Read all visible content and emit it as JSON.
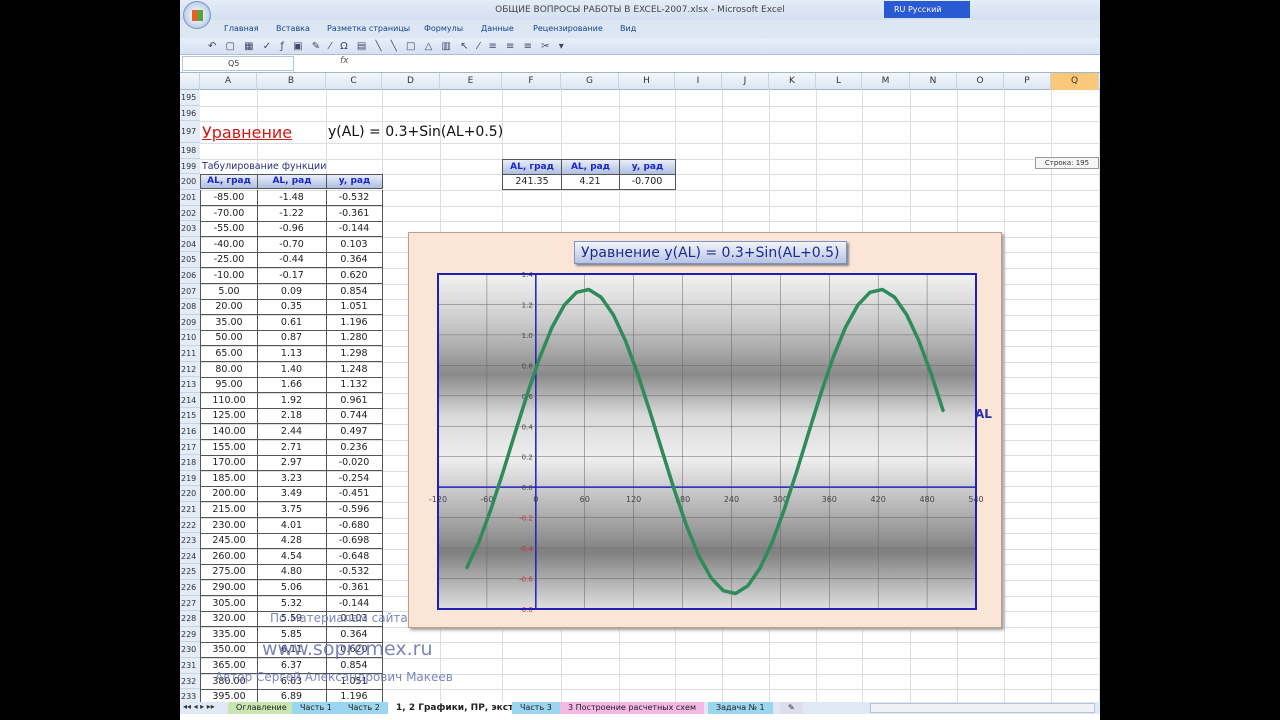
{
  "window": {
    "title": "ОБЩИЕ ВОПРОСЫ РАБОТЫ В EXCEL-2007.xlsx - Microsoft Excel",
    "language": "RU Русский"
  },
  "ribbon_tabs": [
    "Главная",
    "Вставка",
    "Разметка страницы",
    "Формулы",
    "Данные",
    "Рецензирование",
    "Вид"
  ],
  "name_box": "Q5",
  "formula_icon": "fx",
  "columns": [
    "A",
    "B",
    "C",
    "D",
    "E",
    "F",
    "G",
    "H",
    "I",
    "J",
    "K",
    "L",
    "M",
    "N",
    "O",
    "P",
    "Q"
  ],
  "selected_column": "Q",
  "sheet": {
    "equation_label": "Уравнение",
    "equation": "y(AL) = 0.3+Sin(AL+0.5)",
    "tab_title": "Табулирование функции",
    "headers": [
      "AL, град",
      "AL, рад",
      "y, рад"
    ],
    "rows": [
      [
        "-85.00",
        "-1.48",
        "-0.532"
      ],
      [
        "-70.00",
        "-1.22",
        "-0.361"
      ],
      [
        "-55.00",
        "-0.96",
        "-0.144"
      ],
      [
        "-40.00",
        "-0.70",
        "0.103"
      ],
      [
        "-25.00",
        "-0.44",
        "0.364"
      ],
      [
        "-10.00",
        "-0.17",
        "0.620"
      ],
      [
        "5.00",
        "0.09",
        "0.854"
      ],
      [
        "20.00",
        "0.35",
        "1.051"
      ],
      [
        "35.00",
        "0.61",
        "1.196"
      ],
      [
        "50.00",
        "0.87",
        "1.280"
      ],
      [
        "65.00",
        "1.13",
        "1.298"
      ],
      [
        "80.00",
        "1.40",
        "1.248"
      ],
      [
        "95.00",
        "1.66",
        "1.132"
      ],
      [
        "110.00",
        "1.92",
        "0.961"
      ],
      [
        "125.00",
        "2.18",
        "0.744"
      ],
      [
        "140.00",
        "2.44",
        "0.497"
      ],
      [
        "155.00",
        "2.71",
        "0.236"
      ],
      [
        "170.00",
        "2.97",
        "-0.020"
      ],
      [
        "185.00",
        "3.23",
        "-0.254"
      ],
      [
        "200.00",
        "3.49",
        "-0.451"
      ],
      [
        "215.00",
        "3.75",
        "-0.596"
      ],
      [
        "230.00",
        "4.01",
        "-0.680"
      ],
      [
        "245.00",
        "4.28",
        "-0.698"
      ],
      [
        "260.00",
        "4.54",
        "-0.648"
      ],
      [
        "275.00",
        "4.80",
        "-0.532"
      ],
      [
        "290.00",
        "5.06",
        "-0.361"
      ],
      [
        "305.00",
        "5.32",
        "-0.144"
      ],
      [
        "320.00",
        "5.59",
        "0.103"
      ],
      [
        "335.00",
        "5.85",
        "0.364"
      ],
      [
        "350.00",
        "6.11",
        "0.620"
      ],
      [
        "365.00",
        "6.37",
        "0.854"
      ],
      [
        "380.00",
        "6.63",
        "1.051"
      ],
      [
        "395.00",
        "6.89",
        "1.196"
      ]
    ],
    "extreme": {
      "headers": [
        "AL, град",
        "AL, рад",
        "y, рад"
      ],
      "values": [
        "241.35",
        "4.21",
        "-0.700"
      ]
    },
    "row_tooltip": "Строка: 195"
  },
  "chart_data": {
    "type": "line",
    "title": "Уравнение  y(AL) = 0.3+Sin(AL+0.5)",
    "xlabel": "AL",
    "ylabel": "",
    "xlim": [
      -120,
      540
    ],
    "ylim": [
      -0.8,
      1.4
    ],
    "xticks": [
      "-120",
      "-60",
      "0",
      "60",
      "120",
      "180",
      "240",
      "300",
      "360",
      "420",
      "480",
      "540"
    ],
    "yticks": [
      "1.4",
      "1.2",
      "1.0",
      "0.8",
      "0.6",
      "0.4",
      "0.2",
      "0.0",
      "-0.2",
      "-0.4",
      "-0.6",
      "-0.8"
    ],
    "grid": true,
    "color": "#2e8b5a",
    "x": [
      -85,
      -70,
      -55,
      -40,
      -25,
      -10,
      5,
      20,
      35,
      50,
      65,
      80,
      95,
      110,
      125,
      140,
      155,
      170,
      185,
      200,
      215,
      230,
      245,
      260,
      275,
      290,
      305,
      320,
      335,
      350,
      365,
      380,
      395,
      410,
      425,
      440,
      455,
      470,
      485,
      500
    ],
    "y": [
      -0.532,
      -0.361,
      -0.144,
      0.103,
      0.364,
      0.62,
      0.854,
      1.051,
      1.196,
      1.28,
      1.298,
      1.248,
      1.132,
      0.961,
      0.744,
      0.497,
      0.236,
      -0.02,
      -0.254,
      -0.451,
      -0.596,
      -0.68,
      -0.698,
      -0.648,
      -0.532,
      -0.361,
      -0.144,
      0.103,
      0.364,
      0.62,
      0.854,
      1.051,
      1.196,
      1.28,
      1.298,
      1.248,
      1.132,
      0.961,
      0.744,
      0.497
    ]
  },
  "watermark": [
    "По материалам сайта",
    "www.sopromex.ru",
    "Автор Сергей Александрович Макеев"
  ],
  "sheet_tabs": [
    "Оглавление",
    "Часть 1",
    "Часть 2",
    "1, 2 Графики, ПР, экстр",
    "Часть 3",
    "3 Построение расчетных схем",
    "Задача № 1"
  ],
  "active_tab": "1, 2 Графики, ПР, экстр"
}
